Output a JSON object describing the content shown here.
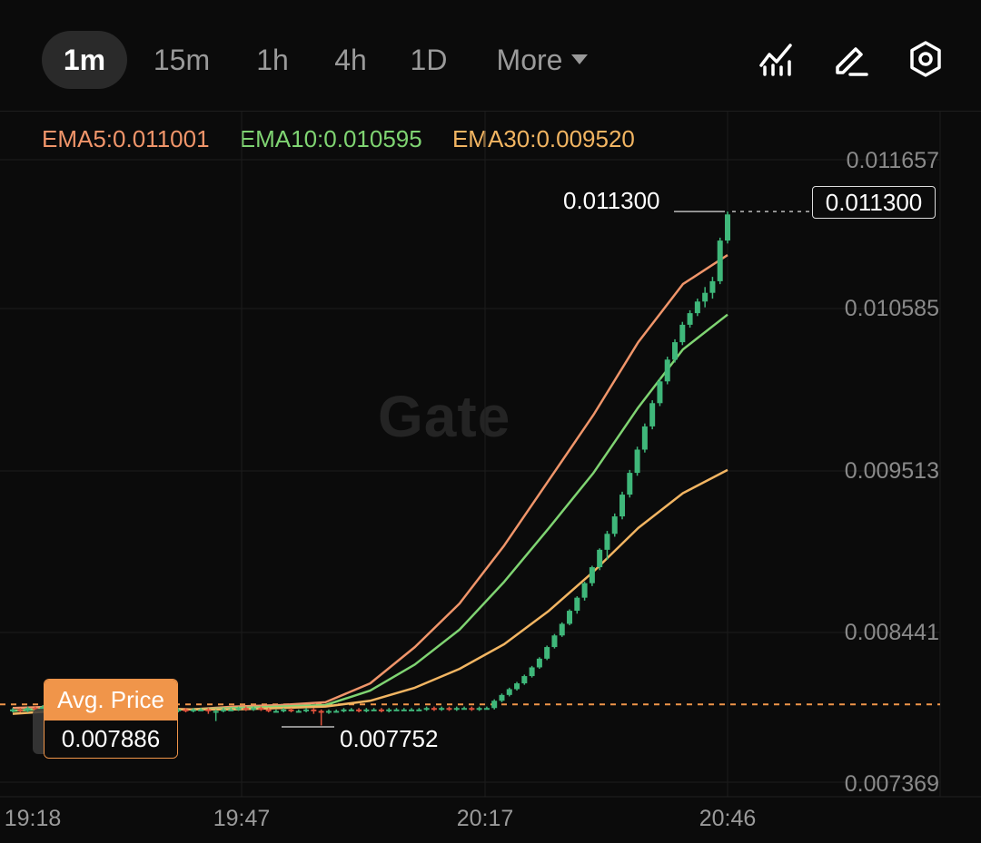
{
  "toolbar": {
    "timeframes": [
      "1m",
      "15m",
      "1h",
      "4h",
      "1D"
    ],
    "active_timeframe": "1m",
    "more_label": "More",
    "icons": [
      "indicator-icon",
      "draw-pen-icon",
      "settings-gear-icon"
    ]
  },
  "ema": {
    "ema5_label": "EMA5:0.011001",
    "ema10_label": "EMA10:0.010595",
    "ema30_label": "EMA30:0.009520"
  },
  "watermark": "Gate",
  "colors": {
    "background": "#0b0b0b",
    "up": "#3fb77a",
    "down": "#e0533d",
    "ema5": "#f0956a",
    "ema10": "#7fd472",
    "ema30": "#f2b562",
    "avg_line": "#f0954a"
  },
  "markers": {
    "high": "0.011300",
    "low": "0.007752",
    "current": "0.011300",
    "avg_price_title": "Avg. Price",
    "avg_price_value": "0.007886"
  },
  "chart_data": {
    "type": "candlestick",
    "y_ticks": [
      "0.011657",
      "0.010585",
      "0.009513",
      "0.008441",
      "0.007369"
    ],
    "ylim": [
      0.007369,
      0.011657
    ],
    "x_ticks": [
      "19:18",
      "19:47",
      "20:17",
      "20:46"
    ],
    "series": [
      {
        "name": "EMA5",
        "values": [
          0.00788,
          0.00789,
          0.00788,
          0.00788,
          0.00787,
          0.00789,
          0.0079,
          0.00792,
          0.00805,
          0.0083,
          0.0086,
          0.009,
          0.00945,
          0.0099,
          0.0104,
          0.0108,
          0.011
        ]
      },
      {
        "name": "EMA10",
        "values": [
          0.00786,
          0.00788,
          0.00788,
          0.00787,
          0.00787,
          0.00788,
          0.00789,
          0.0079,
          0.008,
          0.00818,
          0.00842,
          0.00875,
          0.00912,
          0.0095,
          0.00995,
          0.01035,
          0.01059
        ]
      },
      {
        "name": "EMA30",
        "values": [
          0.00784,
          0.00786,
          0.00787,
          0.00787,
          0.00787,
          0.00787,
          0.00788,
          0.00789,
          0.00793,
          0.00802,
          0.00815,
          0.00832,
          0.00855,
          0.00882,
          0.00912,
          0.00936,
          0.00952
        ]
      }
    ],
    "candles": [
      [
        0.00786,
        0.00787,
        0.00785,
        0.00788
      ],
      [
        0.00787,
        0.00786,
        0.00785,
        0.00788
      ],
      [
        0.00786,
        0.00788,
        0.00785,
        0.00789
      ],
      [
        0.00788,
        0.00787,
        0.00786,
        0.00789
      ],
      [
        0.00787,
        0.00789,
        0.00786,
        0.0079
      ],
      [
        0.00789,
        0.00788,
        0.00787,
        0.0079
      ],
      [
        0.00788,
        0.00788,
        0.00786,
        0.00789
      ],
      [
        0.00788,
        0.00787,
        0.00786,
        0.00789
      ],
      [
        0.00787,
        0.00786,
        0.00784,
        0.00788
      ],
      [
        0.00786,
        0.00785,
        0.00784,
        0.00787
      ],
      [
        0.00785,
        0.00784,
        0.00776,
        0.00786
      ],
      [
        0.00784,
        0.00784,
        0.00775,
        0.00786
      ],
      [
        0.00784,
        0.00785,
        0.00783,
        0.00786
      ],
      [
        0.00785,
        0.00786,
        0.00784,
        0.00787
      ],
      [
        0.00786,
        0.00787,
        0.00785,
        0.00789
      ],
      [
        0.00787,
        0.00788,
        0.00786,
        0.0079
      ],
      [
        0.00788,
        0.00787,
        0.00786,
        0.00789
      ],
      [
        0.00787,
        0.00788,
        0.00786,
        0.00789
      ],
      [
        0.00788,
        0.00786,
        0.00785,
        0.00789
      ],
      [
        0.00786,
        0.00785,
        0.00784,
        0.00787
      ],
      [
        0.00785,
        0.00786,
        0.00783,
        0.00787
      ],
      [
        0.00786,
        0.00786,
        0.00784,
        0.00787
      ],
      [
        0.00786,
        0.00787,
        0.00785,
        0.00788
      ],
      [
        0.00787,
        0.00786,
        0.00785,
        0.00788
      ],
      [
        0.00786,
        0.00787,
        0.00785,
        0.00788
      ],
      [
        0.00787,
        0.00787,
        0.00786,
        0.00788
      ],
      [
        0.00787,
        0.00786,
        0.00784,
        0.00788
      ],
      [
        0.00786,
        0.00786,
        0.00779,
        0.00787
      ],
      [
        0.00786,
        0.00787,
        0.00785,
        0.00788
      ],
      [
        0.00787,
        0.00787,
        0.00786,
        0.00788
      ],
      [
        0.00787,
        0.00788,
        0.00786,
        0.00789
      ],
      [
        0.00788,
        0.00787,
        0.00786,
        0.00789
      ],
      [
        0.00787,
        0.00788,
        0.00786,
        0.00789
      ],
      [
        0.00788,
        0.00787,
        0.00786,
        0.00789
      ],
      [
        0.00787,
        0.00786,
        0.00785,
        0.00788
      ],
      [
        0.00786,
        0.00786,
        0.00785,
        0.00787
      ],
      [
        0.00786,
        0.00787,
        0.00785,
        0.00788
      ],
      [
        0.00787,
        0.00786,
        0.00785,
        0.00788
      ],
      [
        0.00786,
        0.00786,
        0.00785,
        0.00787
      ],
      [
        0.00786,
        0.00787,
        0.00785,
        0.00788
      ],
      [
        0.00787,
        0.00786,
        0.00784,
        0.00788
      ],
      [
        0.00786,
        0.00785,
        0.00776,
        0.00787
      ],
      [
        0.00785,
        0.00786,
        0.00784,
        0.00787
      ],
      [
        0.00786,
        0.00786,
        0.00785,
        0.00787
      ],
      [
        0.00786,
        0.00787,
        0.00785,
        0.00788
      ],
      [
        0.00787,
        0.00787,
        0.00786,
        0.00788
      ],
      [
        0.00787,
        0.00786,
        0.00785,
        0.00788
      ],
      [
        0.00786,
        0.00787,
        0.00785,
        0.00788
      ],
      [
        0.00787,
        0.00787,
        0.00786,
        0.00788
      ],
      [
        0.00787,
        0.00786,
        0.00785,
        0.00788
      ],
      [
        0.00786,
        0.00787,
        0.00785,
        0.00788
      ],
      [
        0.00787,
        0.00787,
        0.00786,
        0.00788
      ],
      [
        0.00787,
        0.00787,
        0.00786,
        0.00788
      ],
      [
        0.00787,
        0.00787,
        0.00786,
        0.00788
      ],
      [
        0.00787,
        0.00787,
        0.00786,
        0.00788
      ],
      [
        0.00787,
        0.00788,
        0.00786,
        0.00789
      ],
      [
        0.00788,
        0.00787,
        0.00786,
        0.00789
      ],
      [
        0.00787,
        0.00788,
        0.00786,
        0.00789
      ],
      [
        0.00788,
        0.00787,
        0.00786,
        0.00789
      ],
      [
        0.00787,
        0.00788,
        0.00786,
        0.00789
      ],
      [
        0.00788,
        0.00788,
        0.00787,
        0.00789
      ],
      [
        0.00788,
        0.00787,
        0.00786,
        0.00789
      ],
      [
        0.00787,
        0.00788,
        0.00786,
        0.00789
      ],
      [
        0.00788,
        0.00788,
        0.00787,
        0.00789
      ],
      [
        0.00788,
        0.00793,
        0.00787,
        0.00794
      ],
      [
        0.00793,
        0.00797,
        0.00792,
        0.00798
      ],
      [
        0.00797,
        0.00801,
        0.00796,
        0.00802
      ],
      [
        0.00801,
        0.00805,
        0.008,
        0.00806
      ],
      [
        0.00805,
        0.0081,
        0.00804,
        0.00811
      ],
      [
        0.0081,
        0.00816,
        0.00809,
        0.00817
      ],
      [
        0.00816,
        0.00822,
        0.00815,
        0.00823
      ],
      [
        0.00822,
        0.0083,
        0.00821,
        0.00831
      ],
      [
        0.0083,
        0.00838,
        0.00829,
        0.00839
      ],
      [
        0.00838,
        0.00846,
        0.00837,
        0.00847
      ],
      [
        0.00846,
        0.00855,
        0.00845,
        0.00856
      ],
      [
        0.00855,
        0.00864,
        0.00853,
        0.00865
      ],
      [
        0.00864,
        0.00874,
        0.00862,
        0.00875
      ],
      [
        0.00874,
        0.00885,
        0.00872,
        0.00886
      ],
      [
        0.00885,
        0.00897,
        0.00883,
        0.00898
      ],
      [
        0.00897,
        0.00908,
        0.0089,
        0.0091
      ],
      [
        0.00908,
        0.0092,
        0.00906,
        0.00922
      ],
      [
        0.0092,
        0.00935,
        0.00918,
        0.00937
      ],
      [
        0.00935,
        0.0095,
        0.00933,
        0.00952
      ],
      [
        0.0095,
        0.00966,
        0.00948,
        0.00968
      ],
      [
        0.00966,
        0.00982,
        0.00964,
        0.00984
      ],
      [
        0.00982,
        0.00998,
        0.0098,
        0.01
      ],
      [
        0.00998,
        0.01013,
        0.00996,
        0.01015
      ],
      [
        0.01013,
        0.01028,
        0.01011,
        0.0103
      ],
      [
        0.01028,
        0.0104,
        0.01026,
        0.01042
      ],
      [
        0.0104,
        0.01052,
        0.01038,
        0.01054
      ],
      [
        0.01052,
        0.0106,
        0.0105,
        0.01062
      ],
      [
        0.0106,
        0.01068,
        0.01058,
        0.0107
      ],
      [
        0.01068,
        0.01074,
        0.01064,
        0.01078
      ],
      [
        0.01074,
        0.01082,
        0.0107,
        0.01085
      ],
      [
        0.01082,
        0.0111,
        0.0108,
        0.01112
      ],
      [
        0.0111,
        0.01128,
        0.01108,
        0.0113
      ]
    ],
    "avg_price": 0.007886,
    "current_price": 0.0113,
    "grid": true
  }
}
